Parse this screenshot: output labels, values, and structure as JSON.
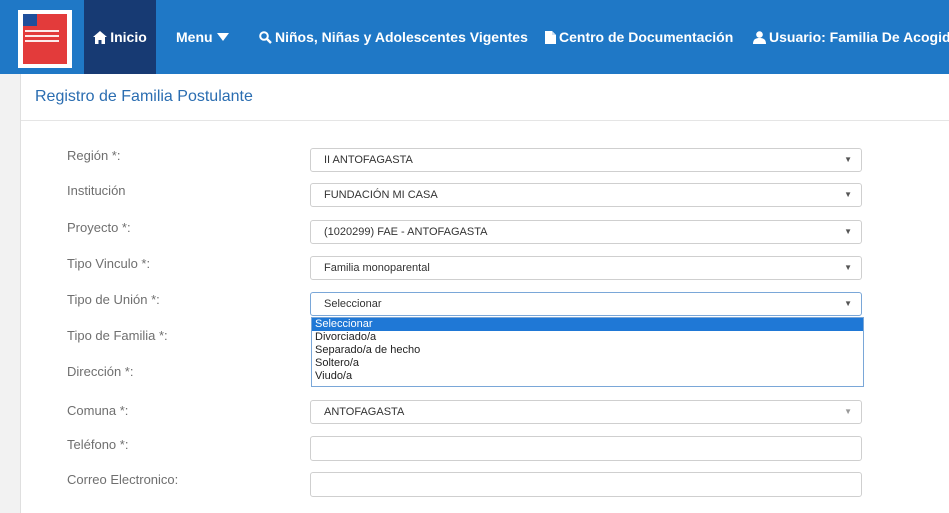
{
  "nav": {
    "home_label": "Inicio",
    "menu_label": "Menu",
    "ninos_label": "Niños, Niñas y Adolescentes Vigentes",
    "docs_label": "Centro de Documentación",
    "user_label": "Usuario: Familia De Acogida"
  },
  "page": {
    "title": "Registro de Familia Postulante"
  },
  "form": {
    "region_label": "Región *:",
    "region_value": "II ANTOFAGASTA",
    "institucion_label": "Institución",
    "institucion_value": "FUNDACIÓN MI CASA",
    "proyecto_label": "Proyecto *:",
    "proyecto_value": "(1020299) FAE - ANTOFAGASTA",
    "tipo_vinculo_label": "Tipo Vinculo *:",
    "tipo_vinculo_value": "Familia monoparental",
    "tipo_union_label": "Tipo de Unión *:",
    "tipo_union_value": "Seleccionar",
    "tipo_familia_label": "Tipo de Familia *:",
    "direccion_label": "Dirección *:",
    "comuna_label": "Comuna *:",
    "comuna_value": "ANTOFAGASTA",
    "telefono_label": "Teléfono *:",
    "correo_label": "Correo Electronico:"
  },
  "dropdown": {
    "options": [
      "Seleccionar",
      "Divorciado/a",
      "Separado/a de hecho",
      "Soltero/a",
      "Viudo/a"
    ],
    "selected_index": 0
  },
  "colors": {
    "topbar": "#1f78c6",
    "nav_active": "#173a73",
    "title": "#2a6db1",
    "option_highlight": "#1f78d6"
  }
}
